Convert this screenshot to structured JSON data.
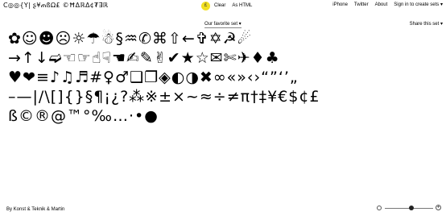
{
  "header": {
    "title": "C◎◎{Y| ʂ¥ጠßΩ£ ©ĦΔℝΔ¢₮∃ℝ",
    "clear_label": "Clear",
    "as_html_label": "As HTML",
    "clear_icon_glyph": "£",
    "links": [
      "iPhone",
      "Twitter",
      "About",
      "Sign in to create sets ▾"
    ]
  },
  "set_selector": {
    "label": "Our favorite set ▾"
  },
  "share_label": "Share this set ▾",
  "glyph_rows": [
    [
      "✿",
      "☺",
      "☻",
      "☹",
      "☼",
      "☂",
      "☃",
      "§",
      "♒",
      "✆",
      "⌘",
      "⇧",
      "←",
      "✞",
      "✡",
      "☭",
      "☄"
    ],
    [
      "→",
      "↑",
      "↓",
      "➫",
      "☜",
      "☞",
      "☝",
      "☟",
      "☚",
      "✍",
      "✎",
      "✌",
      "✔",
      "★",
      "☆",
      "✉",
      "✄",
      "✈",
      "♦",
      "♣"
    ],
    [
      "♥",
      "❤",
      "≡",
      "♪",
      "♫",
      "♬",
      "#",
      "♀",
      "♂",
      "❑",
      "❐",
      "◈",
      "◐",
      "◑",
      "✖",
      "∞",
      "«",
      "»",
      "‹",
      "›",
      "“",
      "”",
      "‘",
      "’",
      "„"
    ],
    [
      "–",
      "—",
      "|",
      "/",
      "\\",
      "[",
      "]",
      "{",
      "}",
      "§",
      "¶",
      "¡",
      "¿",
      "?",
      "⁂",
      "※",
      "±",
      "×",
      "~",
      "≈",
      "÷",
      "≠",
      "π",
      "†",
      "‡",
      "¥",
      "€",
      "$",
      "¢",
      "£"
    ],
    [
      "ß",
      "©",
      "®",
      "@",
      "™",
      "°",
      "‰",
      "…",
      "·",
      "•",
      "●"
    ]
  ],
  "footer": {
    "credit": "By Konst & Teknik & Martin"
  },
  "zoom": {
    "level": 0.55,
    "plus_glyph": "+"
  },
  "colors": {
    "clear_icon": "#f2e020",
    "text": "#000000",
    "background": "#ffffff"
  }
}
